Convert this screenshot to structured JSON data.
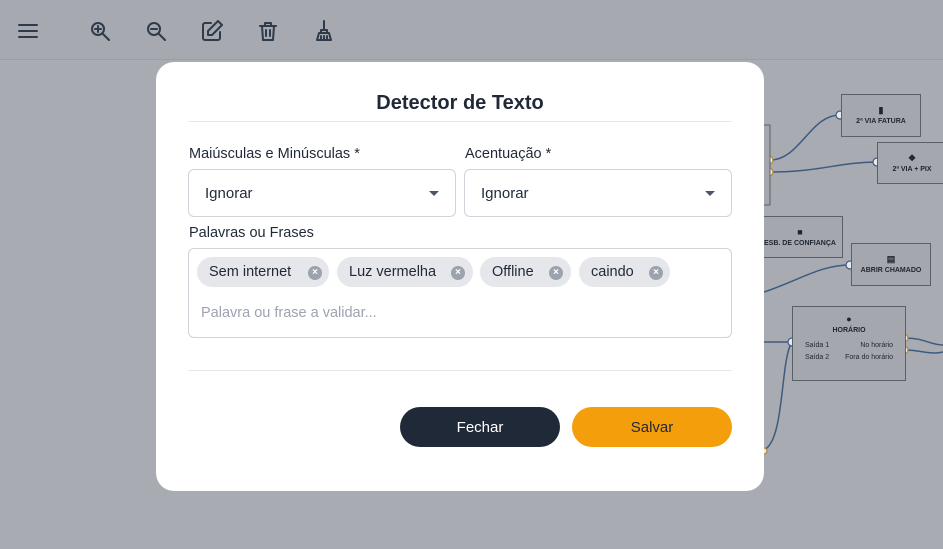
{
  "toolbar": {
    "icons": [
      "menu-icon",
      "zoom-in-icon",
      "zoom-out-icon",
      "edit-icon",
      "trash-icon",
      "broom-icon"
    ]
  },
  "flow": {
    "nodes": [
      {
        "title": "2ª VIA FATURA"
      },
      {
        "title": "2ª VIA + PIX"
      },
      {
        "title": "ESB. DE CONFIANÇA"
      },
      {
        "title": "ABRIR CHAMADO"
      },
      {
        "title": "HORÁRIO",
        "rows": [
          {
            "left": "Saída 1",
            "right": "No horário"
          },
          {
            "left": "Saída 2",
            "right": "Fora do horário"
          }
        ]
      }
    ]
  },
  "modal": {
    "title": "Detector de Texto",
    "case_label": "Maiúsculas e Minúsculas *",
    "case_value": "Ignorar",
    "accent_label": "Acentuação *",
    "accent_value": "Ignorar",
    "words_label": "Palavras ou Frases",
    "tags": [
      "Sem internet",
      "Luz vermelha",
      "Offline",
      "caindo"
    ],
    "input_placeholder": "Palavra ou frase a validar...",
    "close_label": "Fechar",
    "save_label": "Salvar"
  },
  "colors": {
    "primary_dark": "#1f2937",
    "accent": "#f59e0b",
    "backdrop": "#a9adb3"
  }
}
